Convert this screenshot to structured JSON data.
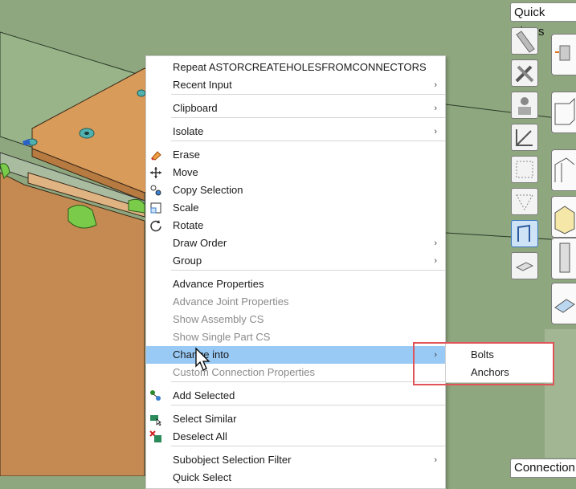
{
  "menu": {
    "items": [
      {
        "label": "Repeat ASTORCREATEHOLESFROMCONNECTORS",
        "submenu": false,
        "disabled": false,
        "icon": ""
      },
      {
        "label": "Recent Input",
        "submenu": true,
        "disabled": false,
        "icon": ""
      },
      {
        "label": "Clipboard",
        "submenu": true,
        "disabled": false,
        "icon": ""
      },
      {
        "label": "Isolate",
        "submenu": true,
        "disabled": false,
        "icon": ""
      },
      {
        "label": "Erase",
        "submenu": false,
        "disabled": false,
        "icon": "eraser-icon"
      },
      {
        "label": "Move",
        "submenu": false,
        "disabled": false,
        "icon": "move-icon"
      },
      {
        "label": "Copy Selection",
        "submenu": false,
        "disabled": false,
        "icon": "copy-icon"
      },
      {
        "label": "Scale",
        "submenu": false,
        "disabled": false,
        "icon": "scale-icon"
      },
      {
        "label": "Rotate",
        "submenu": false,
        "disabled": false,
        "icon": "rotate-icon"
      },
      {
        "label": "Draw Order",
        "submenu": true,
        "disabled": false,
        "icon": ""
      },
      {
        "label": "Group",
        "submenu": true,
        "disabled": false,
        "icon": ""
      },
      {
        "label": "Advance Properties",
        "submenu": false,
        "disabled": false,
        "icon": ""
      },
      {
        "label": "Advance Joint Properties",
        "submenu": false,
        "disabled": true,
        "icon": ""
      },
      {
        "label": "Show Assembly CS",
        "submenu": false,
        "disabled": true,
        "icon": ""
      },
      {
        "label": "Show Single Part CS",
        "submenu": false,
        "disabled": true,
        "icon": ""
      },
      {
        "label": "Change into",
        "submenu": true,
        "disabled": false,
        "highlighted": true,
        "icon": ""
      },
      {
        "label": "Custom Connection Properties",
        "submenu": false,
        "disabled": true,
        "icon": ""
      },
      {
        "label": "Add Selected",
        "submenu": false,
        "disabled": false,
        "icon": "add-selected-icon"
      },
      {
        "label": "Select Similar",
        "submenu": false,
        "disabled": false,
        "icon": "select-similar-icon"
      },
      {
        "label": "Deselect All",
        "submenu": false,
        "disabled": false,
        "icon": "deselect-all-icon"
      },
      {
        "label": "Subobject Selection Filter",
        "submenu": true,
        "disabled": false,
        "icon": ""
      },
      {
        "label": "Quick Select",
        "submenu": false,
        "disabled": false,
        "icon": ""
      }
    ]
  },
  "submenu": {
    "items": [
      {
        "label": "Bolts"
      },
      {
        "label": "Anchors"
      }
    ]
  },
  "palette": {
    "quick_views_label": "Quick views",
    "connection_label": "Connection"
  },
  "colors": {
    "highlight": "#99c9f5",
    "annotation_box": "#e05358",
    "model_background": "#8fa77e",
    "plate": "#d99b5a"
  }
}
